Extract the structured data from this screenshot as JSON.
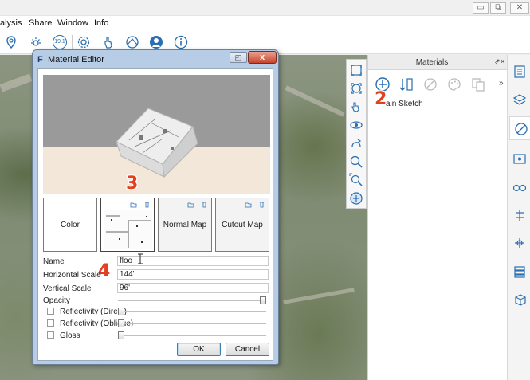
{
  "window": {
    "minimize": "▭",
    "restore": "⧉",
    "close": "✕"
  },
  "menu": {
    "items": [
      "alysis",
      "Share",
      "Window",
      "Info"
    ]
  },
  "toolbar": {
    "badge_text": "19.1"
  },
  "materials_panel": {
    "title": "Materials",
    "pin": "⇗",
    "close": "×",
    "overflow": "»",
    "item_label": "ain Sketch"
  },
  "dialog": {
    "logo": "F",
    "title": "Material Editor",
    "close_label": "x",
    "minimize_label": "◰",
    "slots": {
      "color": "Color",
      "normal_map": "Normal Map",
      "cutout_map": "Cutout Map"
    },
    "fields": {
      "name_label": "Name",
      "name_value": "floo",
      "horizontal_scale_label": "Horizontal Scale",
      "horizontal_scale_value": "144'",
      "vertical_scale_label": "Vertical Scale",
      "vertical_scale_value": "96'",
      "opacity_label": "Opacity",
      "opacity_level": 1.0,
      "reflectivity_direct_label": "Reflectivity (Direct)",
      "reflectivity_direct_level": 0,
      "reflectivity_oblique_label": "Reflectivity (Oblique)",
      "reflectivity_oblique_level": 0,
      "gloss_label": "Gloss",
      "gloss_level": 0
    },
    "buttons": {
      "ok": "OK",
      "cancel": "Cancel"
    }
  },
  "callouts": {
    "step2": "2",
    "step3": "3",
    "step4": "4"
  },
  "colors": {
    "callout": "#e2401f",
    "dialog_frame": "#b7cde6",
    "accent_blue": "#2a6fb0"
  }
}
